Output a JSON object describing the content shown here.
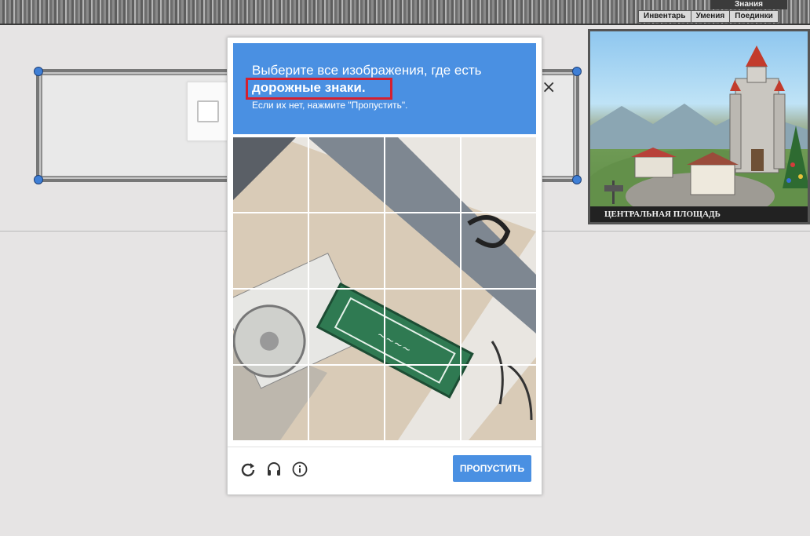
{
  "game": {
    "knowledge_tab": "Знания",
    "tabs": [
      "Инвентарь",
      "Умения",
      "Поединки"
    ],
    "location_label": "ЦЕНТРАЛЬНАЯ ПЛОЩАДЬ"
  },
  "captcha": {
    "prompt_line1": "Выберите все изображения, где есть",
    "prompt_target": "дорожные знаки.",
    "prompt_hint": "Если их нет, нажмите \"Пропустить\".",
    "skip_label": "ПРОПУСТИТЬ",
    "header_color": "#4a90e2",
    "highlight_color": "#d4202f",
    "tools": [
      "reload-icon",
      "audio-icon",
      "info-icon"
    ]
  },
  "close_symbol": "×"
}
